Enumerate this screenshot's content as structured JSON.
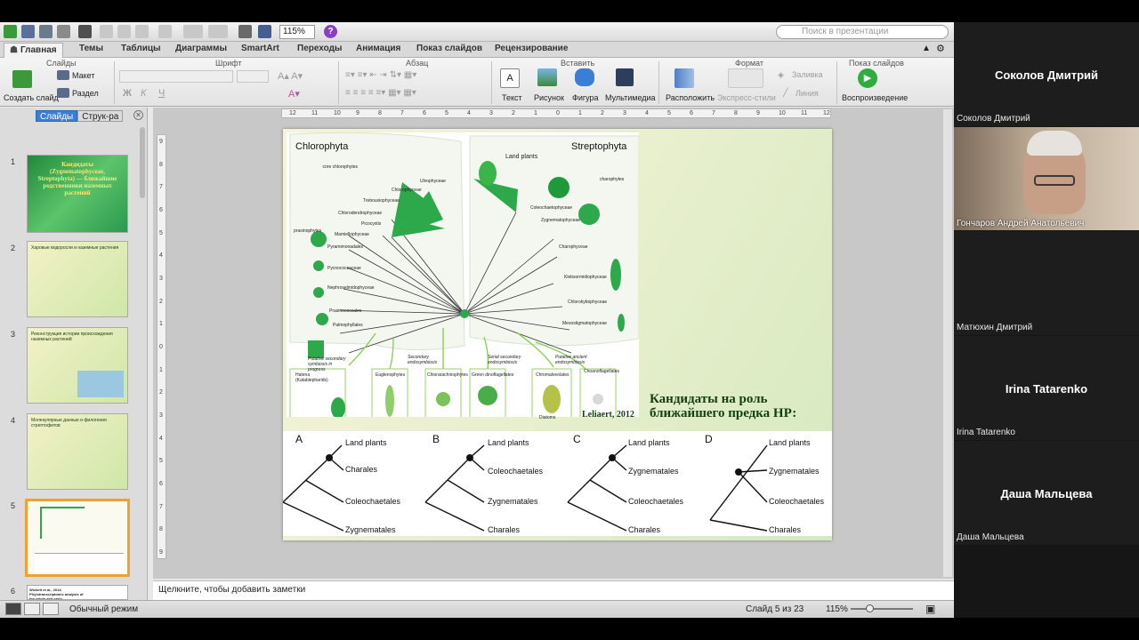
{
  "toolbar": {
    "zoom": "115%",
    "help": "?",
    "search_placeholder": "Поиск в презентации"
  },
  "tabs": [
    "Главная",
    "Темы",
    "Таблицы",
    "Диаграммы",
    "SmartArt",
    "Переходы",
    "Анимация",
    "Показ слайдов",
    "Рецензирование"
  ],
  "ribbon": {
    "groups": [
      "Слайды",
      "Шрифт",
      "Абзац",
      "Вставить",
      "Формат",
      "Показ слайдов"
    ],
    "new_slide": "Создать слайд",
    "layout": "Макет",
    "section": "Раздел",
    "bold": "Ж",
    "italic": "К",
    "underline": "Ч",
    "text": "Текст",
    "picture": "Рисунок",
    "shape": "Фигура",
    "media": "Мультимедиа",
    "arrange": "Расположить",
    "quick_styles": "Экспресс-стили",
    "fill": "Заливка",
    "line": "Линия",
    "play": "Воспроизведение"
  },
  "sidebar": {
    "tab_slides": "Слайды",
    "tab_outline": "Струк-ра",
    "thumbs": [
      {
        "num": "1",
        "text": "Кандидаты (Zygnematophyceae, Streptophyta) — ближайшие родственники наземных растений"
      },
      {
        "num": "2",
        "text": "Харовые водоросли и наземные растения"
      },
      {
        "num": "3",
        "text": "Реконструкция истории происхождения наземных растений"
      },
      {
        "num": "4",
        "text": "Молекулярные данные и филогения стрептофитов"
      },
      {
        "num": "5",
        "text": ""
      },
      {
        "num": "6",
        "text": "Wickett et al., 2014. Phylotranscriptomic analysis of the origin and early diversification of land plants"
      }
    ]
  },
  "rulers": {
    "h": [
      "12",
      "11",
      "10",
      "9",
      "8",
      "7",
      "6",
      "5",
      "4",
      "3",
      "2",
      "1",
      "0",
      "1",
      "2",
      "3",
      "4",
      "5",
      "6",
      "7",
      "8",
      "9",
      "10",
      "11",
      "12"
    ],
    "v": [
      "9",
      "8",
      "7",
      "6",
      "5",
      "4",
      "3",
      "2",
      "1",
      "0",
      "1",
      "2",
      "3",
      "4",
      "5",
      "6",
      "7",
      "8",
      "9"
    ]
  },
  "slide": {
    "chlorophyta": "Chlorophyta",
    "streptophyta": "Streptophyta",
    "left_clades": [
      "core chlorophytes",
      "prasinophytes",
      "Ulvophyceae",
      "Chlorophyceae",
      "Trebouxiophyceae",
      "Chlorodendrophyceae",
      "Picocystis",
      "Mamiellophyceae",
      "Pyramimonadales",
      "Pycnococcaceae",
      "Nephroselmidophyceae",
      "Prasinococcales",
      "Palmophyllales"
    ],
    "right_clades": [
      "Land plants",
      "charophytes",
      "Coleochaetophyceae",
      "Zygnematophyceae",
      "Charophyceae",
      "Klebsormidiophyceae",
      "Chlorokybophyceae",
      "Mesostigmatophyceae"
    ],
    "endosym": [
      "Putative secondary symbiosis in progress",
      "Secondary endosymbiosis",
      "Serial secondary endosymbiosis",
      "Putative ancient endosymbiosis",
      "Choanoflagellates"
    ],
    "endosym_groups": [
      "Hatena (Katablepharids)",
      "Euglenophytes",
      "Chlorarachniophytes",
      "Green dinoflagellates",
      "Chromalveolates",
      "Diatoms"
    ],
    "citation": "Leliaert, 2012",
    "candidates_line1": "Кандидаты на роль",
    "candidates_line2": "ближайшего предка НР:",
    "trees": [
      {
        "letter": "A",
        "taxa": [
          "Land plants",
          "Charales",
          "Coleochaetales",
          "Zygnematales"
        ]
      },
      {
        "letter": "B",
        "taxa": [
          "Land plants",
          "Coleochaetales",
          "Zygnematales",
          "Charales"
        ]
      },
      {
        "letter": "C",
        "taxa": [
          "Land plants",
          "Zygnematales",
          "Coleochaetales",
          "Charales"
        ]
      },
      {
        "letter": "D",
        "taxa": [
          "Land plants",
          "Zygnematales",
          "Coleochaetales",
          "Charales"
        ]
      }
    ]
  },
  "notes_placeholder": "Щелкните, чтобы добавить заметки",
  "status": {
    "mode": "Обычный режим",
    "slide_counter": "Слайд 5 из 23",
    "zoom": "115%"
  },
  "participants": [
    {
      "center": "Соколов Дмитрий",
      "foot": "Соколов Дмитрий",
      "video": false
    },
    {
      "center": "",
      "foot": "Гончаров Андрей Анатольевич",
      "video": true
    },
    {
      "center": "",
      "foot": "Матюхин Дмитрий",
      "video": false
    },
    {
      "center": "Irina Tatarenko",
      "foot": "Irina Tatarenko",
      "video": false
    },
    {
      "center": "Даша Мальцева",
      "foot": "Даша Мальцева",
      "video": false
    }
  ],
  "colors": {
    "accent_tab": "#3a7fd5",
    "slide_title_green": "#123f12",
    "selected_thumb": "#f0a030",
    "tree_green": "#2da84a"
  }
}
